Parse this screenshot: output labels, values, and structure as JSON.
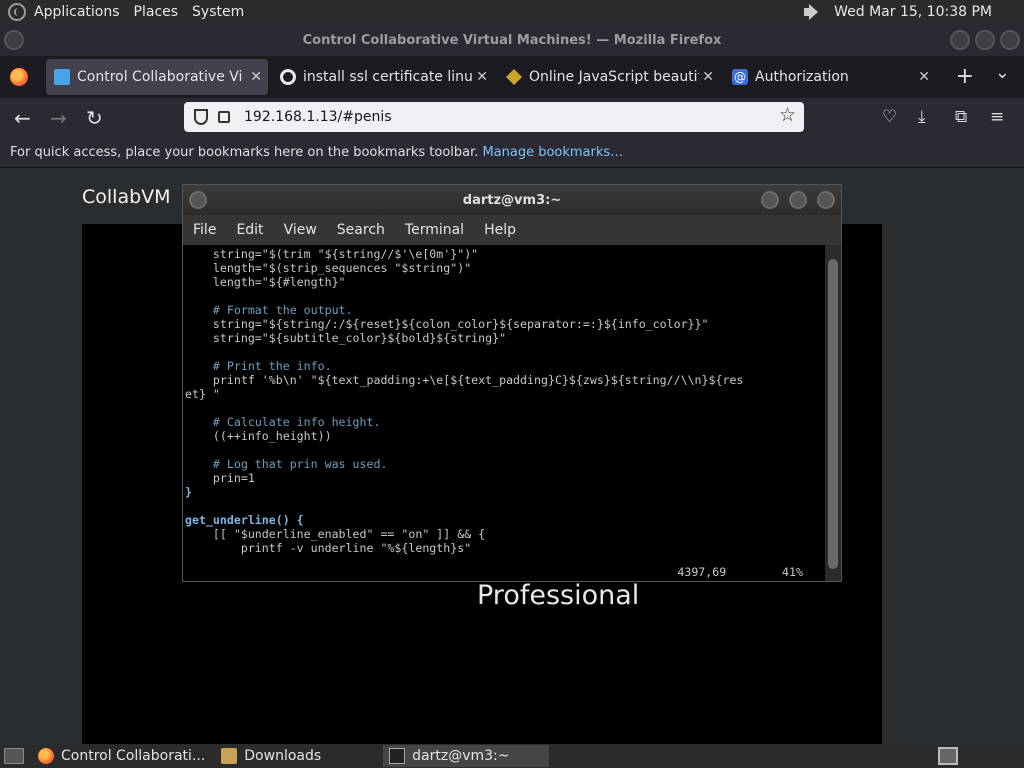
{
  "top_panel": {
    "menus": [
      "Applications",
      "Places",
      "System"
    ],
    "clock": "Wed Mar 15, 10:38 PM"
  },
  "window": {
    "title": "Control Collaborative Virtual Machines! — Mozilla Firefox"
  },
  "tabs": [
    {
      "label": "Control Collaborative Virtual Machines!",
      "icon": "vm-icon",
      "active": true
    },
    {
      "label": "install ssl certificate linux - Google Search",
      "icon": "google-icon",
      "active": false
    },
    {
      "label": "Online JavaScript beautifier",
      "icon": "js-beautifier-icon",
      "active": false
    },
    {
      "label": "Authorization",
      "icon": "authorization-icon",
      "active": false
    }
  ],
  "nav": {
    "url": "192.168.1.13/#penis"
  },
  "bookmarks_bar": {
    "message": "For quick access, place your bookmarks here on the bookmarks toolbar.",
    "link": "Manage bookmarks…"
  },
  "page": {
    "site_title": "CollabVM",
    "vm_text": "Professional"
  },
  "terminal": {
    "title": "dartz@vm3:~",
    "menu": [
      "File",
      "Edit",
      "View",
      "Search",
      "Terminal",
      "Help"
    ],
    "lines": [
      "    string=\"$(trim \"${string//$'\\e[0m'}\")\"",
      "    length=\"$(strip_sequences \"$string\")\"",
      "    length=\"${#length}\"",
      "",
      "    # Format the output.",
      "    string=\"${string/:/${reset}${colon_color}${separator:=:}${info_color}}\"",
      "    string=\"${subtitle_color}${bold}${string}\"",
      "",
      "    # Print the info.",
      "    printf '%b\\n' \"${text_padding:+\\e[${text_padding}C}${zws}${string//\\\\n}${res",
      "et} \"",
      "",
      "    # Calculate info height.",
      "    ((++info_height))",
      "",
      "    # Log that prin was used.",
      "    prin=1",
      "}",
      "",
      "get_underline() {",
      "    [[ \"$underline_enabled\" == \"on\" ]] && {",
      "        printf -v underline \"%${length}s\""
    ],
    "status": "4397,69        41%"
  },
  "taskbar": {
    "items": [
      {
        "label": "Control Collaborati...",
        "icon": "firefox-icon"
      },
      {
        "label": "Downloads",
        "icon": "folder-icon"
      },
      {
        "label": "dartz@vm3:~",
        "icon": "terminal-icon"
      }
    ]
  }
}
